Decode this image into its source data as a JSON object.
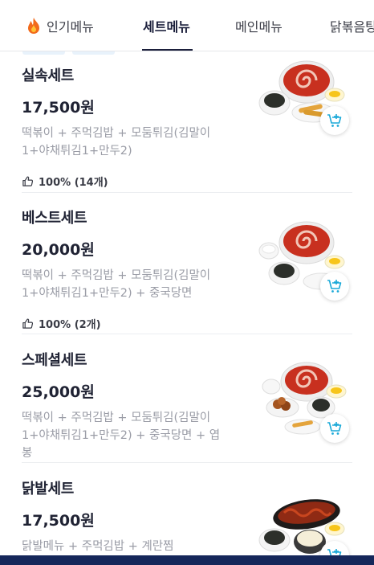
{
  "tabs": [
    {
      "label": "인기메뉴",
      "icon": "fire-icon"
    },
    {
      "label": "세트메뉴",
      "active": true
    },
    {
      "label": "메인메뉴"
    },
    {
      "label": "닭볶음탕"
    }
  ],
  "items": [
    {
      "name": "실속세트",
      "price": "17,500원",
      "desc": "떡볶이 + 주먹김밥 + 모둠튀김(김말이1+야채튀김1+만두2)",
      "rating": "100% (14개)"
    },
    {
      "name": "베스트세트",
      "price": "20,000원",
      "desc": "떡볶이 + 주먹김밥 + 모둠튀김(김말이1+야채튀김1+만두2) + 중국당면",
      "rating": "100% (2개)"
    },
    {
      "name": "스페셜세트",
      "price": "25,000원",
      "desc": "떡볶이 + 주먹김밥 + 모둠튀김(김말이1+야채튀김1+만두2) + 중국당면 + 엽봉"
    },
    {
      "name": "닭발세트",
      "price": "17,500원",
      "desc": "닭발메뉴 + 주먹김밥 + 계란찜"
    }
  ],
  "colors": {
    "accent": "#1b1f3b",
    "cart": "#1aa9d8",
    "sauce": "#c8301f",
    "bottom_bar": "#15275a"
  }
}
